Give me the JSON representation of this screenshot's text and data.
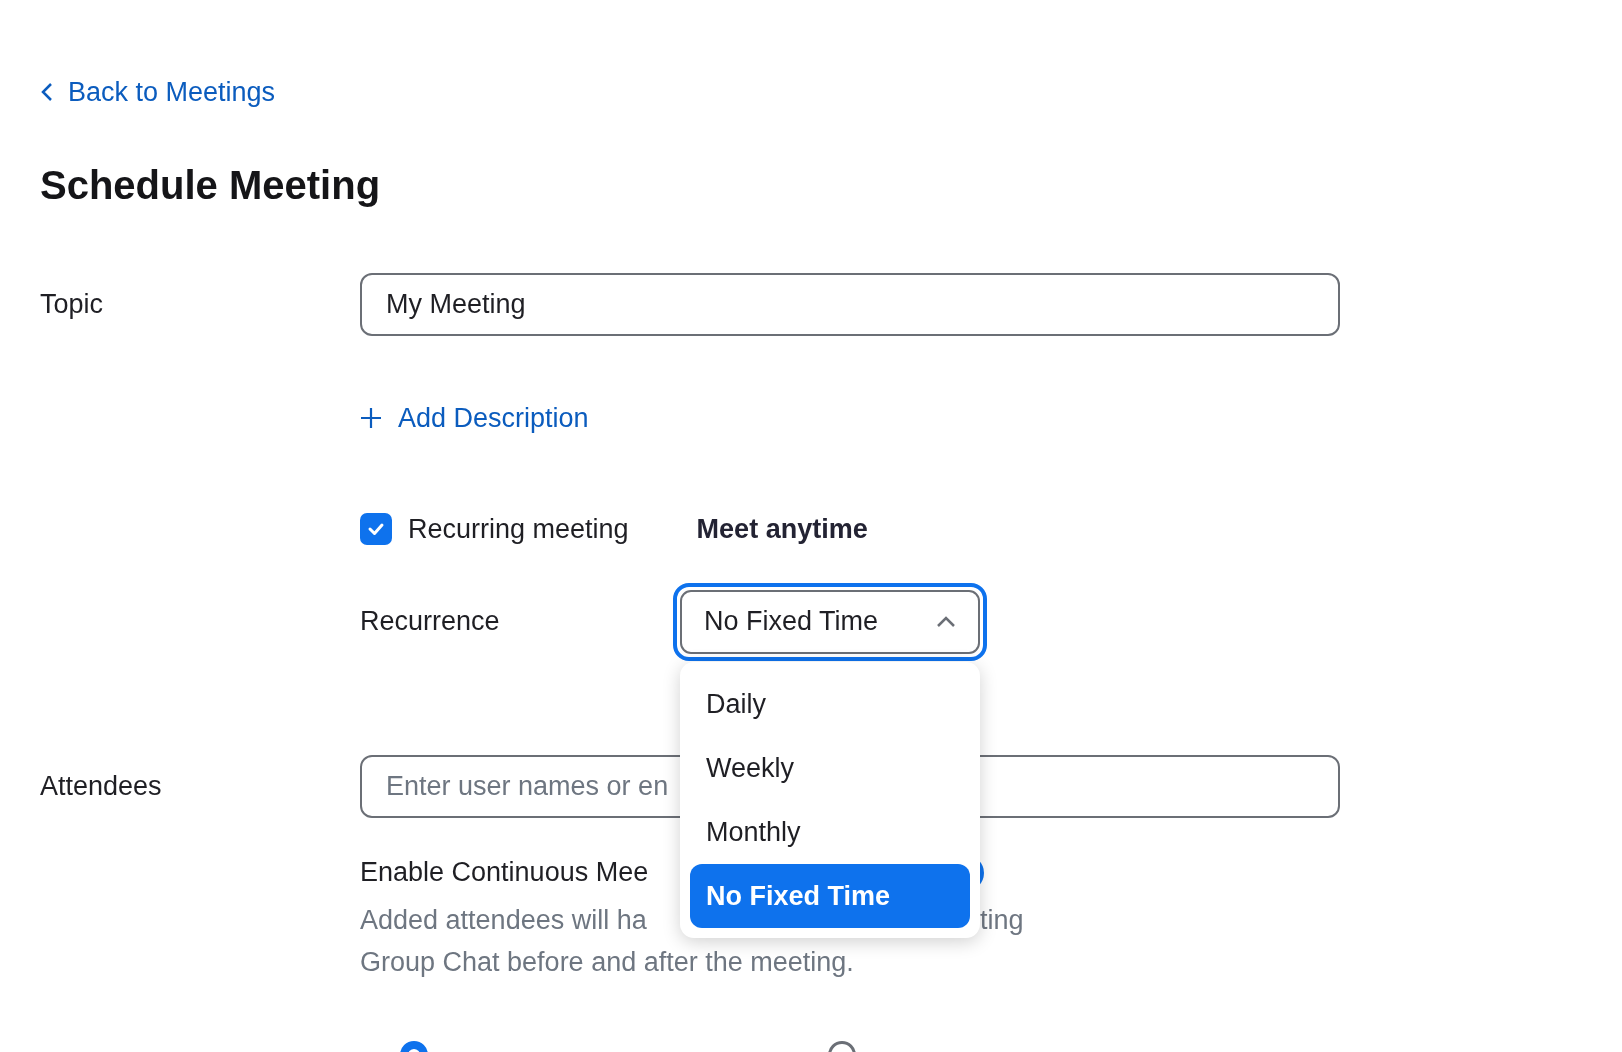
{
  "back_link": {
    "label": "Back to Meetings"
  },
  "title": "Schedule Meeting",
  "topic": {
    "label": "Topic",
    "value": "My Meeting"
  },
  "add_description": {
    "label": "Add Description"
  },
  "recurring": {
    "label": "Recurring meeting",
    "checked": true,
    "note": "Meet anytime"
  },
  "recurrence": {
    "label": "Recurrence",
    "value": "No Fixed Time",
    "expanded": true,
    "options": [
      {
        "label": "Daily",
        "selected": false
      },
      {
        "label": "Weekly",
        "selected": false
      },
      {
        "label": "Monthly",
        "selected": false
      },
      {
        "label": "No Fixed Time",
        "selected": true
      }
    ]
  },
  "attendees": {
    "label": "Attendees",
    "placeholder": "Enter user names or en"
  },
  "continuous_chat": {
    "label": "Enable Continuous Mee",
    "on": true,
    "description": [
      "Added attendees will ha",
      "ting",
      "Group Chat before and after the meeting."
    ]
  },
  "radio_options": [
    {
      "selected": true
    },
    {
      "selected": false
    }
  ]
}
